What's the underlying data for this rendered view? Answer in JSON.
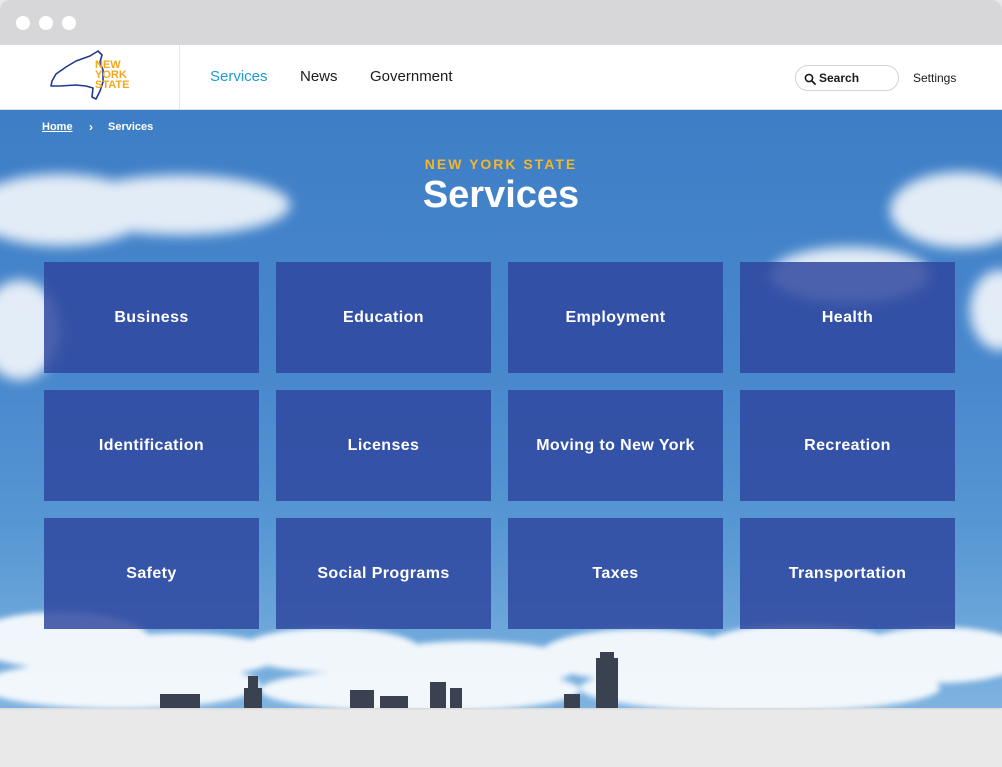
{
  "window": {
    "controls": [
      "close",
      "minimize",
      "maximize"
    ]
  },
  "header": {
    "logo": {
      "lines": [
        "NEW",
        "YORK",
        "STATE"
      ],
      "colors": {
        "text": "#f5a81c",
        "outline": "#1f3a93"
      }
    },
    "nav": [
      {
        "label": "Services",
        "active": true
      },
      {
        "label": "News",
        "active": false
      },
      {
        "label": "Government",
        "active": false
      }
    ],
    "search": {
      "label": "Search",
      "icon": "search-icon"
    },
    "settings_label": "Settings"
  },
  "breadcrumb": {
    "home": "Home",
    "separator": "›",
    "current": "Services"
  },
  "hero": {
    "eyebrow": "NEW YORK STATE",
    "title": "Services"
  },
  "tiles": [
    {
      "label": "Business"
    },
    {
      "label": "Education"
    },
    {
      "label": "Employment"
    },
    {
      "label": "Health"
    },
    {
      "label": "Identification"
    },
    {
      "label": "Licenses"
    },
    {
      "label": "Moving to New York"
    },
    {
      "label": "Recreation"
    },
    {
      "label": "Safety"
    },
    {
      "label": "Social Programs"
    },
    {
      "label": "Taxes"
    },
    {
      "label": "Transportation"
    }
  ],
  "colors": {
    "accent_link": "#1b9ad6",
    "eyebrow": "#f5b62a",
    "tile": "#2f469e",
    "sky": "#4988cd"
  }
}
